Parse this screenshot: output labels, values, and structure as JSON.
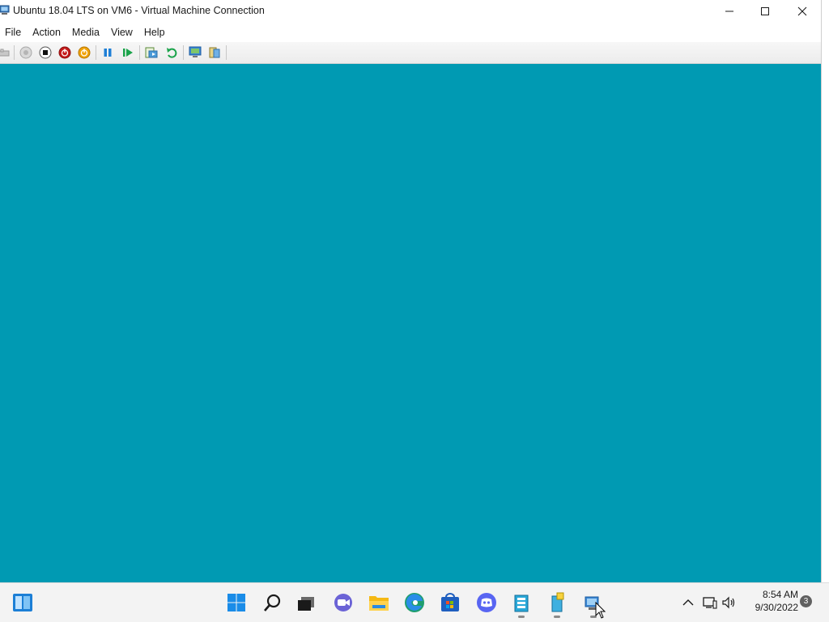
{
  "window": {
    "title": "Ubuntu 18.04 LTS on VM6 - Virtual Machine Connection"
  },
  "menu": {
    "items": [
      {
        "label": "File"
      },
      {
        "label": "Action"
      },
      {
        "label": "Media"
      },
      {
        "label": "View"
      },
      {
        "label": "Help"
      }
    ]
  },
  "toolbar": {
    "buttons": [
      {
        "icon": "ctrl-alt-del-icon"
      },
      {
        "icon": "start-icon"
      },
      {
        "icon": "turn-off-icon"
      },
      {
        "icon": "shut-down-icon"
      },
      {
        "icon": "save-icon"
      },
      {
        "icon": "pause-icon"
      },
      {
        "icon": "resume-icon"
      },
      {
        "icon": "checkpoint-icon"
      },
      {
        "icon": "revert-icon"
      },
      {
        "icon": "enhanced-session-icon"
      },
      {
        "icon": "share-icon"
      }
    ]
  },
  "screen": {
    "background": "#009ab3"
  },
  "taskbar": {
    "apps": [
      {
        "icon": "start-windows-icon"
      },
      {
        "icon": "search-icon"
      },
      {
        "icon": "task-view-icon"
      },
      {
        "icon": "chat-icon"
      },
      {
        "icon": "file-explorer-icon"
      },
      {
        "icon": "edge-icon"
      },
      {
        "icon": "store-icon"
      },
      {
        "icon": "discord-icon"
      },
      {
        "icon": "hyper-v-manager-icon"
      },
      {
        "icon": "server-manager-icon"
      },
      {
        "icon": "vm-connection-icon"
      }
    ],
    "tray": {
      "time": "8:54 AM",
      "date": "9/30/2022",
      "notification_count": "3"
    }
  },
  "colors": {
    "accent": "#0078d4",
    "vm_background": "#009ab3"
  }
}
